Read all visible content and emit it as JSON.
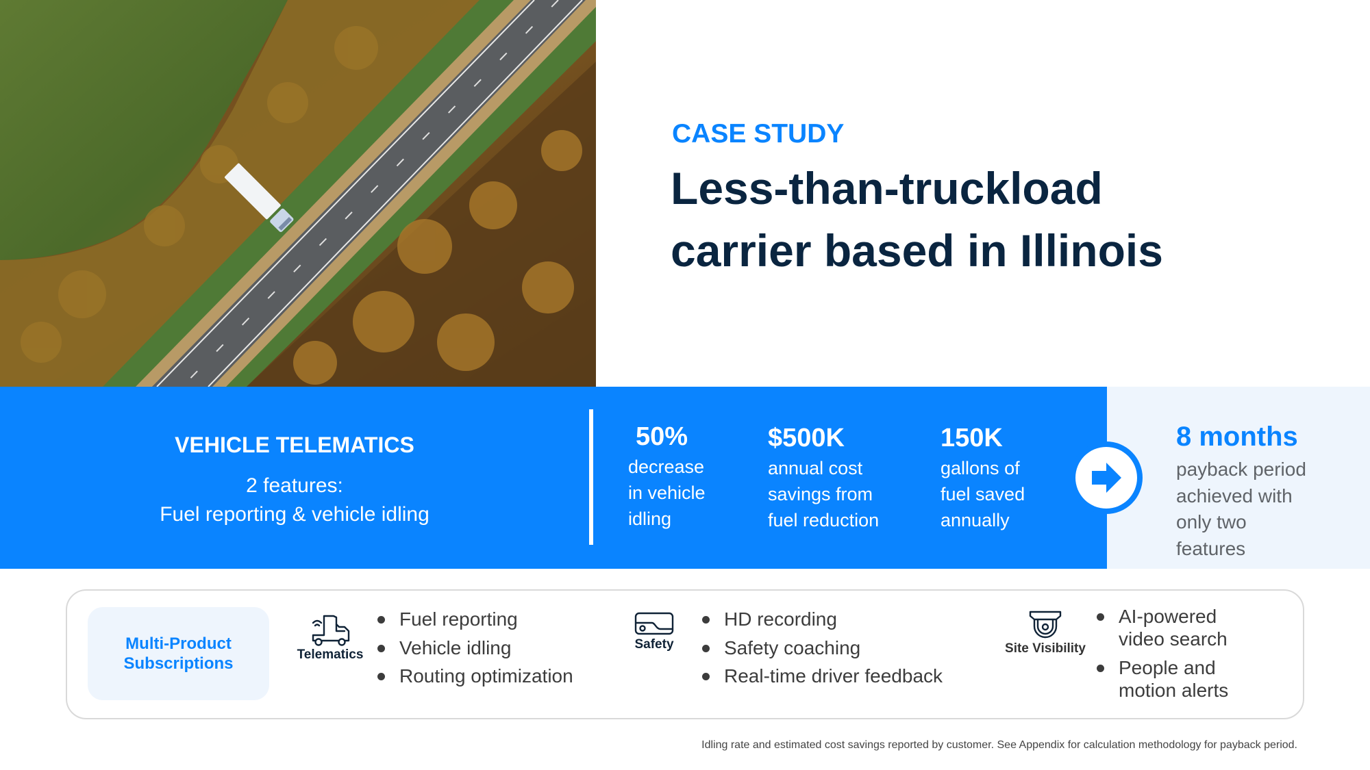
{
  "hero": {
    "image_alt": "Aerial view of a white semi-truck on a highway through autumn forest and green fields",
    "eyebrow": "CASE STUDY",
    "headline_lines": [
      "Less-than-truckload",
      "carrier based in Illinois"
    ]
  },
  "product": {
    "title": "VEHICLE TELEMATICS",
    "feature_count": "2 features:",
    "features": "Fuel reporting & vehicle idling"
  },
  "stats": [
    {
      "value": "50%",
      "desc_lines": [
        "decrease",
        "in vehicle",
        "idling"
      ]
    },
    {
      "value": "$500K",
      "desc_lines": [
        "annual cost",
        "savings from",
        "fuel reduction"
      ]
    },
    {
      "value": "150K",
      "desc_lines": [
        "gallons of",
        "fuel saved",
        "annually"
      ]
    }
  ],
  "payback": {
    "icon": "arrow-right-icon",
    "value": "8 months",
    "desc_lines": [
      "payback period",
      "achieved with",
      "only two",
      "features"
    ]
  },
  "subscriptions": {
    "label": "Multi-Product\nSubscriptions",
    "products": [
      {
        "name": "Telematics",
        "icon": "truck-wifi-icon",
        "bullets": [
          "Fuel reporting",
          "Vehicle idling",
          "Routing optimization"
        ]
      },
      {
        "name": "Safety",
        "icon": "dashcam-icon",
        "bullets": [
          "HD recording",
          "Safety coaching",
          "Real-time driver feedback"
        ]
      },
      {
        "name": "Site Visibility",
        "icon": "security-camera-icon",
        "bullets": [
          "AI-powered video search",
          "People and motion alerts"
        ]
      }
    ]
  },
  "footnote": "Idling rate and estimated cost savings reported by customer. See Appendix for calculation methodology for payback period.",
  "colors": {
    "accent_blue": "#0a84ff",
    "headline_navy": "#0a2540",
    "panel_tint": "#eef5fd",
    "body_gray": "#3c3c3c",
    "muted_gray": "#5f6368"
  }
}
